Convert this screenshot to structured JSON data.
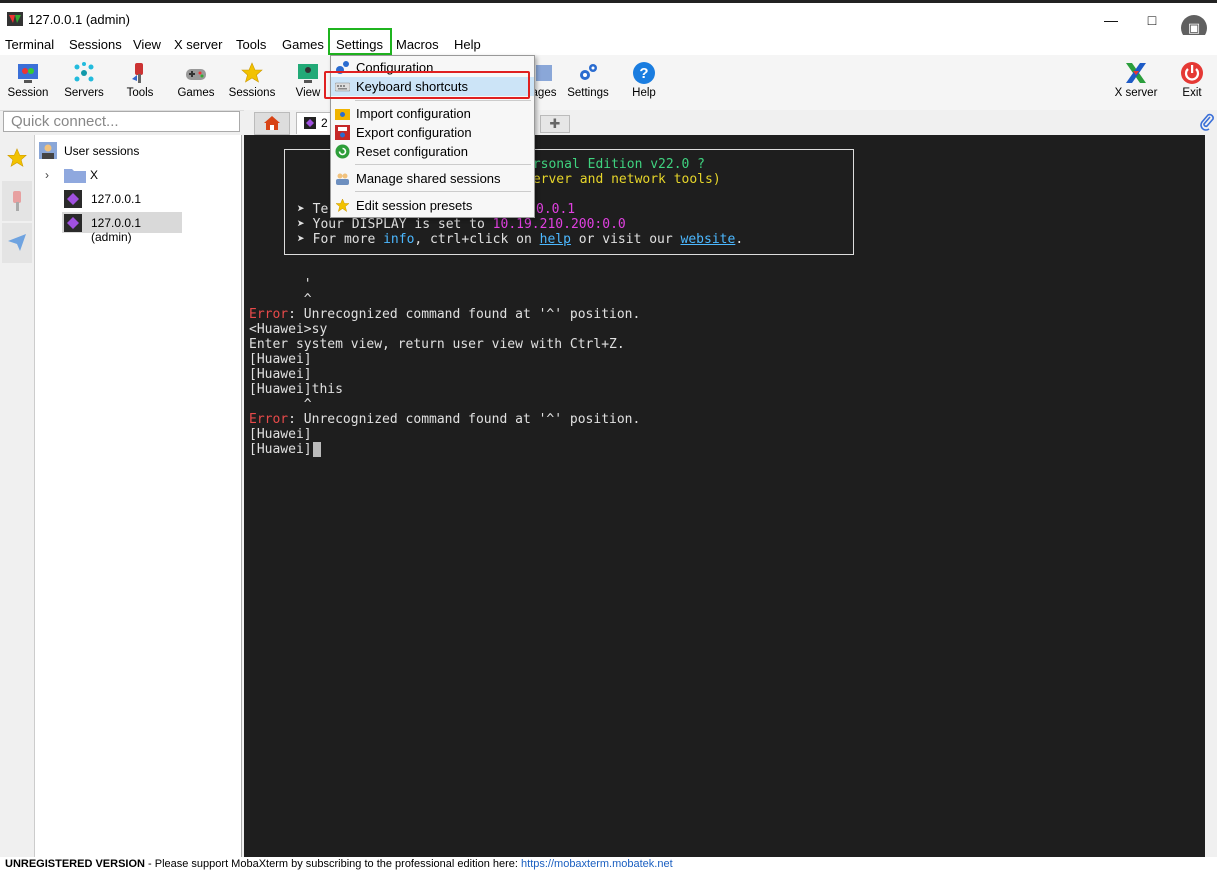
{
  "window": {
    "title": "127.0.0.1 (admin)"
  },
  "menubar": {
    "items": [
      "Terminal",
      "Sessions",
      "View",
      "X server",
      "Tools",
      "Games",
      "Settings",
      "Macros",
      "Help"
    ]
  },
  "toolbar": {
    "left": [
      {
        "label": "Session",
        "icon": "session-icon"
      },
      {
        "label": "Servers",
        "icon": "servers-icon"
      },
      {
        "label": "Tools",
        "icon": "tools-icon"
      },
      {
        "label": "Games",
        "icon": "games-icon"
      },
      {
        "label": "Sessions",
        "icon": "sessions-star-icon"
      },
      {
        "label": "View",
        "icon": "view-icon"
      }
    ],
    "partial_label": "ages",
    "settings_label": "Settings",
    "help_label": "Help",
    "xserver_label": "X server",
    "exit_label": "Exit"
  },
  "quick_connect": {
    "placeholder": "Quick connect..."
  },
  "tabs": {
    "active_tab_prefix": "2"
  },
  "sessions_tree": {
    "root": "User sessions",
    "folder": "X",
    "items": [
      "127.0.0.1",
      "127.0.0.1 (admin)"
    ]
  },
  "settings_menu": {
    "items": [
      {
        "label": "Configuration",
        "icon": "gears-icon"
      },
      {
        "label": "Keyboard shortcuts",
        "icon": "keyboard-icon"
      },
      {
        "label": "Import configuration",
        "icon": "import-icon"
      },
      {
        "label": "Export configuration",
        "icon": "export-icon"
      },
      {
        "label": "Reset configuration",
        "icon": "reset-icon"
      },
      {
        "label": "Manage shared sessions",
        "icon": "shared-sessions-icon"
      },
      {
        "label": "Edit session presets",
        "icon": "presets-star-icon"
      }
    ]
  },
  "terminal": {
    "banner_line1": "ersonal Edition v22.0 ?",
    "banner_line2": "server and network tools)",
    "banner_line3_prefix": "➤ Te",
    "banner_line3_value": "0.0.1",
    "display_prefix": "➤ Your DISPLAY is set to ",
    "display_value": "10.19.210.200:0.0",
    "more_prefix": "➤ For more ",
    "more_info": "info",
    "more_mid": ", ctrl+click on ",
    "more_help": "help",
    "more_mid2": " or visit our ",
    "more_website": "website",
    "more_end": ".",
    "lines": [
      {
        "text": "       '"
      },
      {
        "text": "       ^"
      },
      {
        "err": "Error",
        "text": ": Unrecognized command found at '^' position."
      },
      {
        "text": "<Huawei>sy"
      },
      {
        "text": "Enter system view, return user view with Ctrl+Z."
      },
      {
        "text": "[Huawei]"
      },
      {
        "text": "[Huawei]"
      },
      {
        "text": "[Huawei]this"
      },
      {
        "text": "       ^"
      },
      {
        "err": "Error",
        "text": ": Unrecognized command found at '^' position."
      },
      {
        "text": "[Huawei]"
      },
      {
        "text": "[Huawei]"
      }
    ],
    "colors": {
      "error": "#e84a4a",
      "green": "#3fd27f",
      "yellow": "#e6d52a",
      "magenta": "#e040e0",
      "cyan": "#4cb8ff"
    }
  },
  "status": {
    "unregistered": "UNREGISTERED VERSION",
    "message": "  -  Please support MobaXterm by subscribing to the professional edition here:  ",
    "link": "https://mobaxterm.mobatek.net"
  }
}
